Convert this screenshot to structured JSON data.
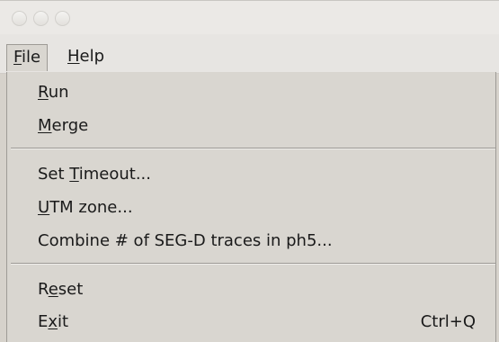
{
  "window": {
    "buttons": [
      "close",
      "minimize",
      "maximize"
    ]
  },
  "menubar": {
    "items": [
      {
        "label_mnemonic": "F",
        "label_rest": "ile",
        "open": true
      },
      {
        "label_mnemonic": "H",
        "label_rest": "elp",
        "open": false
      }
    ]
  },
  "file_menu": {
    "items": [
      {
        "pre": "",
        "mnemonic": "R",
        "post": "un",
        "shortcut": ""
      },
      {
        "pre": "",
        "mnemonic": "M",
        "post": "erge",
        "shortcut": ""
      },
      {
        "pre": "Set ",
        "mnemonic": "T",
        "post": "imeout...",
        "shortcut": ""
      },
      {
        "pre": "",
        "mnemonic": "U",
        "post": "TM zone...",
        "shortcut": ""
      },
      {
        "pre": "Combine # of SEG-D traces in ph5...",
        "mnemonic": "",
        "post": "",
        "shortcut": ""
      },
      {
        "pre": "R",
        "mnemonic": "e",
        "post": "set",
        "shortcut": ""
      },
      {
        "pre": "E",
        "mnemonic": "x",
        "post": "it",
        "shortcut": "Ctrl+Q"
      }
    ]
  },
  "colors": {
    "menu_bg": "#d9d6d0",
    "titlebar_bg": "#ebe9e6",
    "text": "#1a1a1a"
  }
}
